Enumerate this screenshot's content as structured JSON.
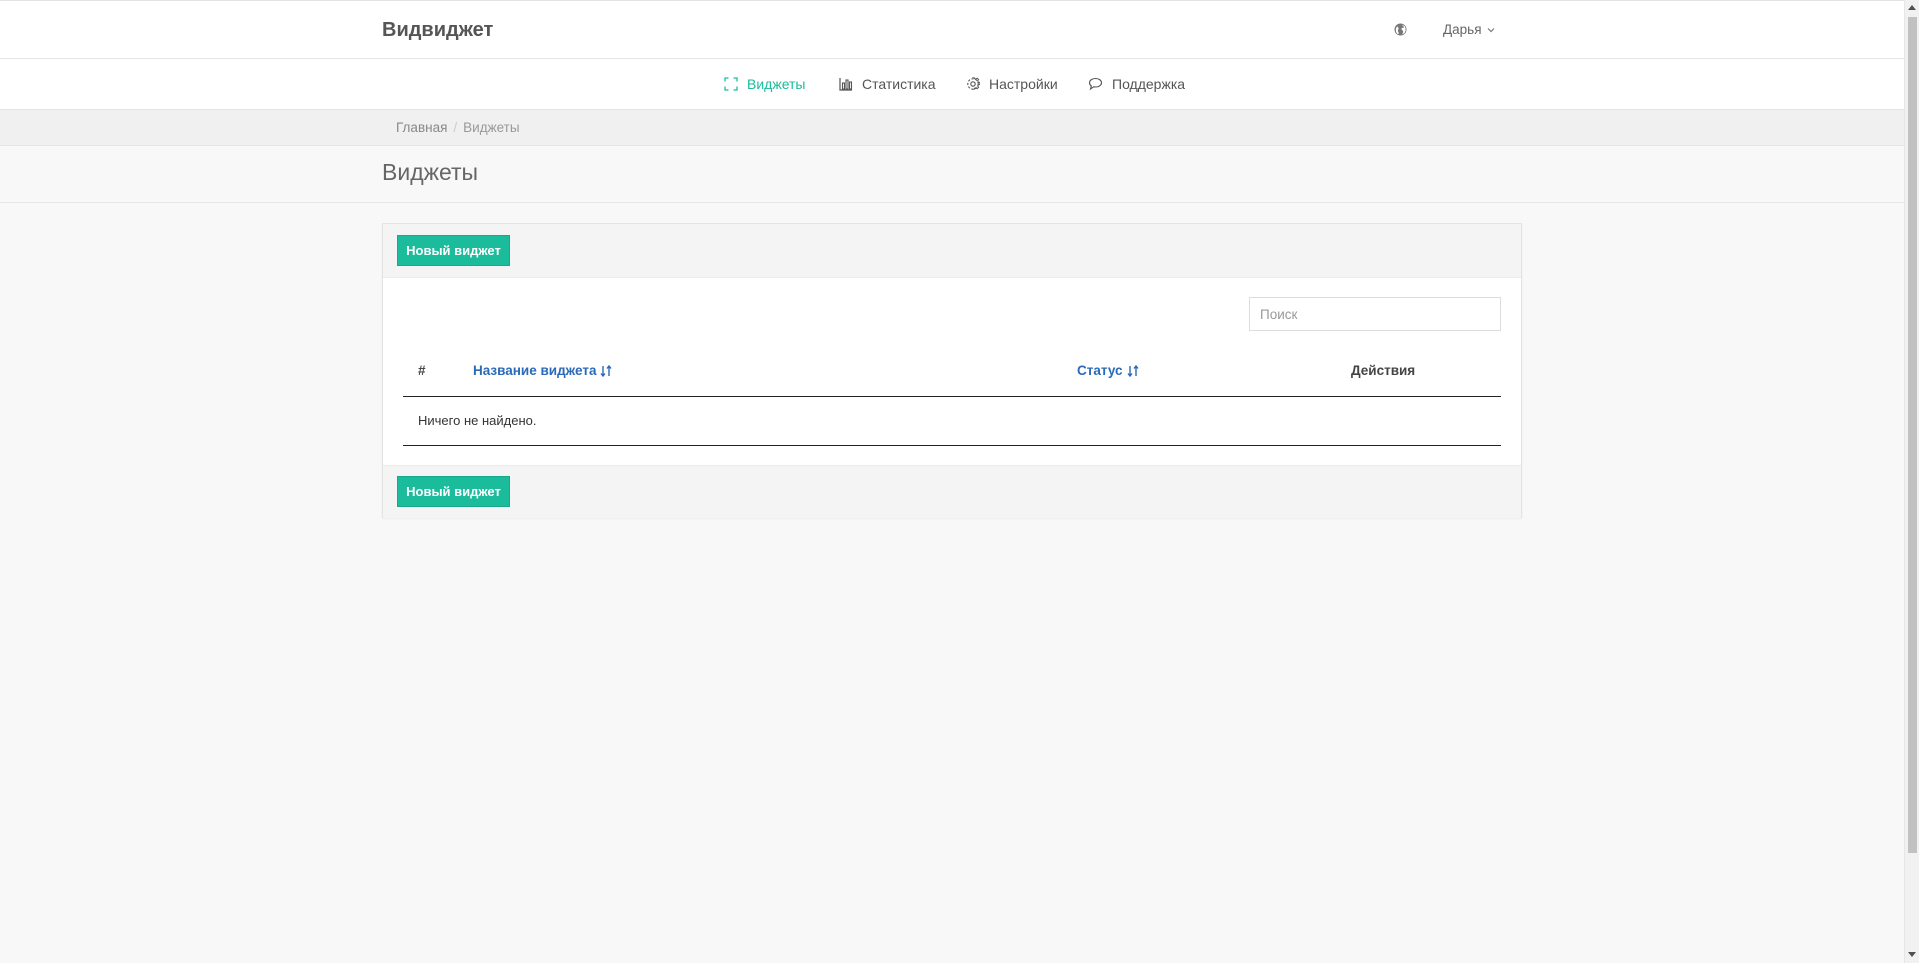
{
  "brand": "Видвиджет",
  "user": {
    "name": "Дарья"
  },
  "nav": {
    "items": [
      {
        "label": "Виджеты",
        "icon": "expand-icon",
        "active": true
      },
      {
        "label": "Статистика",
        "icon": "bar-chart-icon",
        "active": false
      },
      {
        "label": "Настройки",
        "icon": "gear-icon",
        "active": false
      },
      {
        "label": "Поддержка",
        "icon": "speech-bubble-icon",
        "active": false
      }
    ]
  },
  "breadcrumb": {
    "home": "Главная",
    "separator": "/",
    "current": "Виджеты"
  },
  "page": {
    "title": "Виджеты"
  },
  "panel": {
    "new_button": "Новый виджет",
    "search_placeholder": "Поиск",
    "table": {
      "columns": [
        "#",
        "Название виджета",
        "Статус",
        "Действия"
      ],
      "empty": "Ничего не найдено."
    }
  },
  "colors": {
    "accent": "#1abc9c",
    "link": "#2a6ab8"
  }
}
